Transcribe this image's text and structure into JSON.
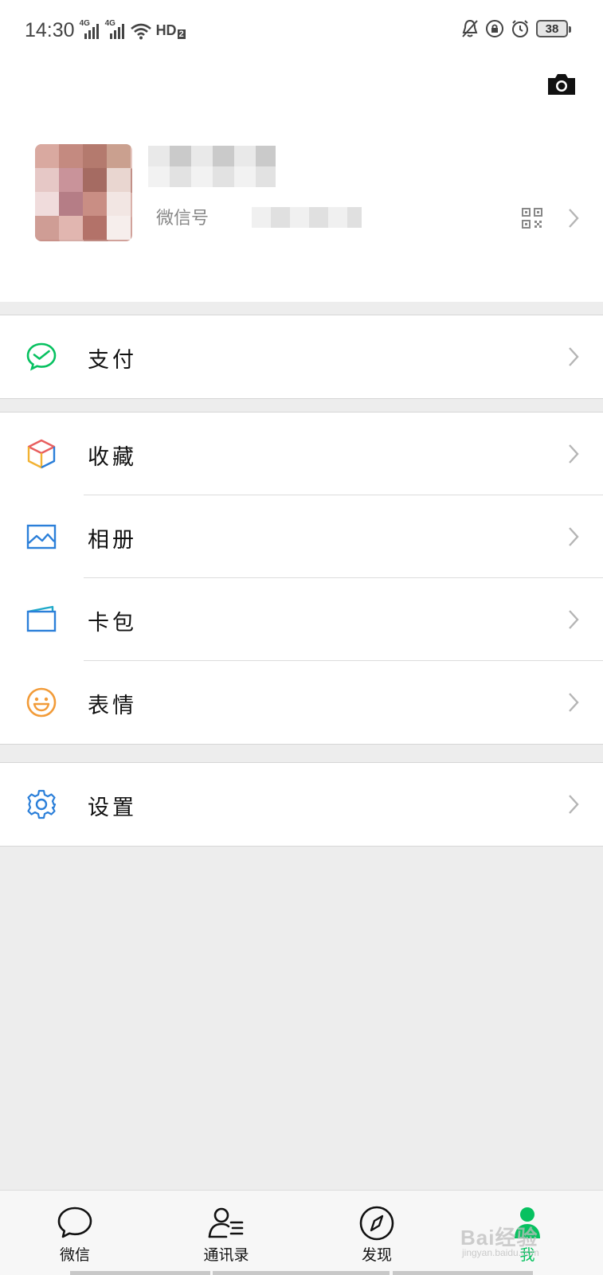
{
  "status_bar": {
    "time": "14:30",
    "signal_1": "4G",
    "signal_2": "4G",
    "hd_label": "HD",
    "hd_sub": "2",
    "battery": "38"
  },
  "profile": {
    "wechat_id_label": "微信号"
  },
  "menu": {
    "pay": {
      "label": "支付",
      "icon": "wechat-pay-icon"
    },
    "favorites": {
      "label": "收藏",
      "icon": "favorites-cube-icon"
    },
    "album": {
      "label": "相册",
      "icon": "album-picture-icon"
    },
    "cards": {
      "label": "卡包",
      "icon": "card-wallet-icon"
    },
    "stickers": {
      "label": "表情",
      "icon": "smiley-icon"
    },
    "settings": {
      "label": "设置",
      "icon": "gear-icon"
    }
  },
  "tabs": [
    {
      "label": "微信",
      "icon": "chat-bubble-icon",
      "active": false
    },
    {
      "label": "通讯录",
      "icon": "contacts-icon",
      "active": false
    },
    {
      "label": "发现",
      "icon": "compass-icon",
      "active": false
    },
    {
      "label": "我",
      "icon": "me-person-icon",
      "active": true
    }
  ],
  "watermark": {
    "text": "Bai经验",
    "sub": "jingyan.baidu.com"
  },
  "colors": {
    "wechat_green": "#07c160",
    "background": "#ededed",
    "icon_blue": "#2b7fd9",
    "icon_orange": "#f29b38",
    "chevron": "#b5b5b5"
  }
}
